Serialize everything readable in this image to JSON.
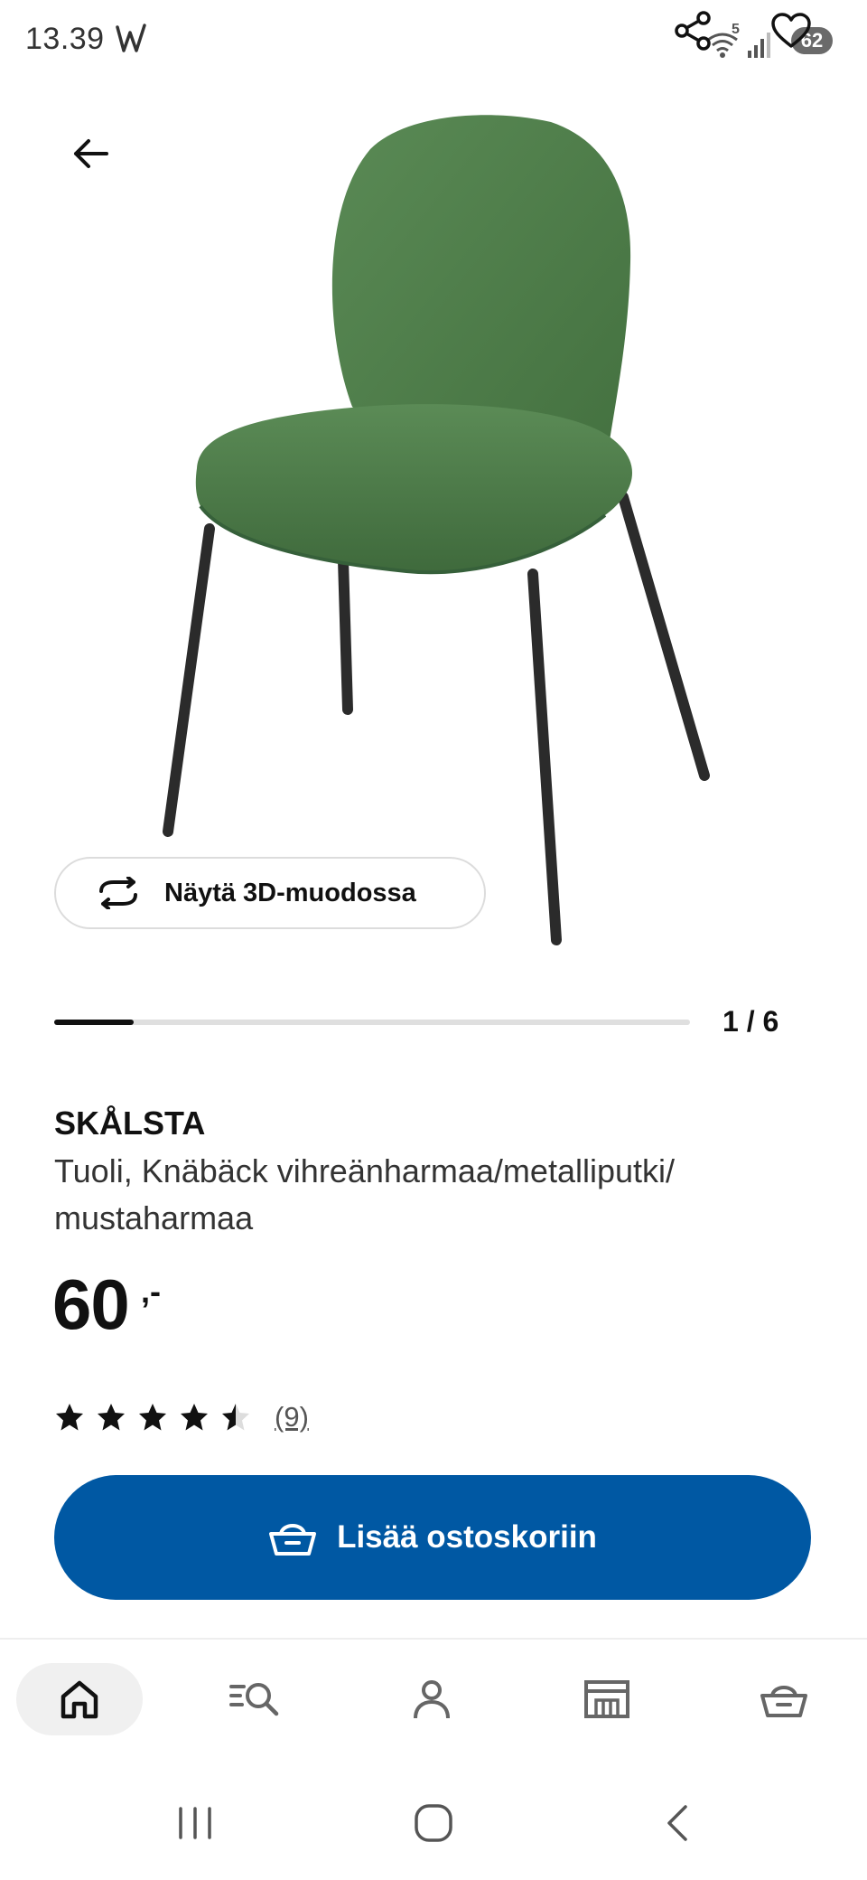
{
  "status_bar": {
    "time": "13.39",
    "app_indicator": "W",
    "wifi_badge": "5",
    "battery": "62"
  },
  "header": {
    "back_icon": "arrow-left-icon",
    "share_icon": "share-icon",
    "favorite_icon": "heart-icon"
  },
  "gallery": {
    "view_3d_label": "Näytä 3D-muodossa",
    "current_page": 1,
    "total_pages": 6,
    "counter_text": "1 / 6"
  },
  "product": {
    "name": "SKÅLSTA",
    "description": "Tuoli, Knäbäck vihreänharmaa/metalliputki/ mustaharmaa",
    "price": "60",
    "price_suffix": ",-",
    "rating": 4.5,
    "rating_max": 5,
    "review_count": "(9)"
  },
  "cart": {
    "add_label": "Lisää ostoskoriin"
  },
  "bottom_nav": {
    "items": [
      {
        "name": "home",
        "icon": "home-icon",
        "active": true
      },
      {
        "name": "search",
        "icon": "search-list-icon",
        "active": false
      },
      {
        "name": "profile",
        "icon": "person-icon",
        "active": false
      },
      {
        "name": "store",
        "icon": "store-icon",
        "active": false
      },
      {
        "name": "cart",
        "icon": "basket-icon",
        "active": false
      }
    ]
  },
  "colors": {
    "accent": "#0058a3",
    "text": "#111111",
    "chair_fabric": "#4e7d4b",
    "chair_legs": "#2a2a2a"
  }
}
